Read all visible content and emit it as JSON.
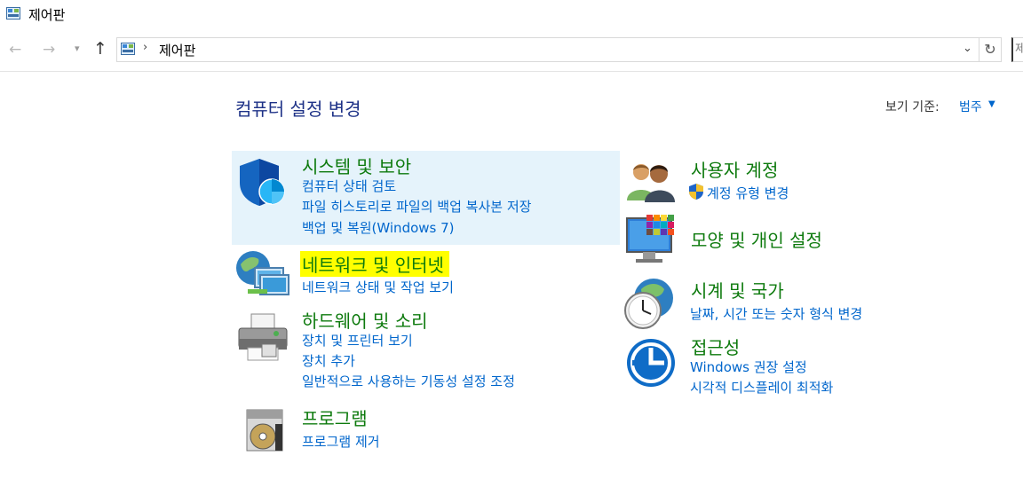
{
  "window": {
    "title": "제어판"
  },
  "nav": {
    "address": "제어판",
    "search_placeholder": "제"
  },
  "header": {
    "title": "컴퓨터 설정 변경",
    "view_by_label": "보기 기준:",
    "view_by_value": "범주"
  },
  "categories": {
    "system_security": {
      "title": "시스템 및 보안",
      "links": [
        "컴퓨터 상태 검토",
        "파일 히스토리로 파일의 백업 복사본 저장",
        "백업 및 복원(Windows 7)"
      ]
    },
    "network": {
      "title": "네트워크 및 인터넷",
      "links": [
        "네트워크 상태 및 작업 보기"
      ]
    },
    "hardware": {
      "title": "하드웨어 및 소리",
      "links": [
        "장치 및 프린터 보기",
        "장치 추가",
        "일반적으로 사용하는 기동성 설정 조정"
      ]
    },
    "programs": {
      "title": "프로그램",
      "links": [
        "프로그램 제거"
      ]
    },
    "user_accounts": {
      "title": "사용자 계정",
      "links": [
        "계정 유형 변경"
      ]
    },
    "appearance": {
      "title": "모양 및 개인 설정",
      "links": []
    },
    "clock": {
      "title": "시계 및 국가",
      "links": [
        "날짜, 시간 또는 숫자 형식 변경"
      ]
    },
    "ease": {
      "title": "접근성",
      "links": [
        "Windows 권장 설정",
        "시각적 디스플레이 최적화"
      ]
    }
  },
  "colors": {
    "category_title": "#0d7a0d",
    "link": "#0066cc",
    "highlight_bg": "#e5f3fb",
    "search_highlight": "#ffff00"
  },
  "icons": [
    "control-panel-icon",
    "back-arrow-icon",
    "forward-arrow-icon",
    "up-arrow-icon",
    "refresh-icon",
    "shield-icon",
    "network-globe-icon",
    "printer-icon",
    "programs-disc-icon",
    "users-icon",
    "display-colors-icon",
    "clock-globe-icon",
    "ease-of-access-icon",
    "uac-shield-icon"
  ]
}
